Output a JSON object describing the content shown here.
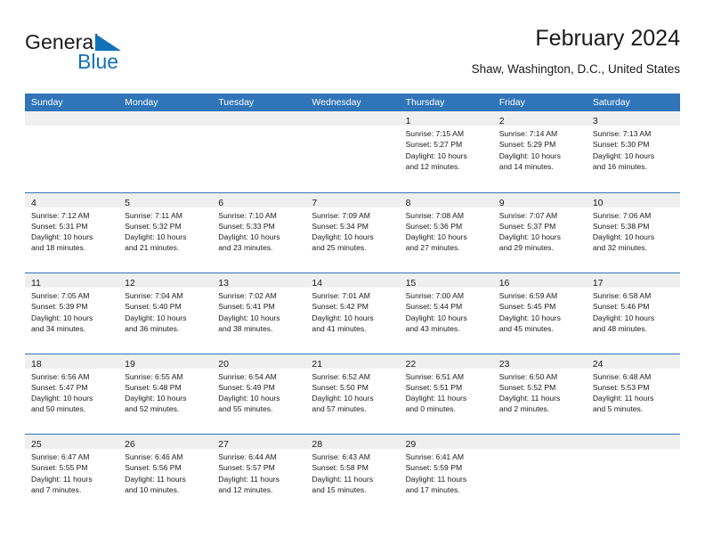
{
  "brand": {
    "name_top": "General",
    "name_bottom": "Blue",
    "triangle_color": "#1272b8",
    "text_color": "#1a1a1a"
  },
  "header": {
    "title": "February 2024",
    "subtitle": "Shaw, Washington, D.C., United States"
  },
  "theme": {
    "header_blue": "#3075b8",
    "daynum_band": "#efefef",
    "cell_bg": "#ffffff",
    "text": "#1a1a1a"
  },
  "weekdays": [
    "Sunday",
    "Monday",
    "Tuesday",
    "Wednesday",
    "Thursday",
    "Friday",
    "Saturday"
  ],
  "weeks": [
    [
      {
        "day": "",
        "sunrise": "",
        "sunset": "",
        "daylight_1": "",
        "daylight_2": ""
      },
      {
        "day": "",
        "sunrise": "",
        "sunset": "",
        "daylight_1": "",
        "daylight_2": ""
      },
      {
        "day": "",
        "sunrise": "",
        "sunset": "",
        "daylight_1": "",
        "daylight_2": ""
      },
      {
        "day": "",
        "sunrise": "",
        "sunset": "",
        "daylight_1": "",
        "daylight_2": ""
      },
      {
        "day": "1",
        "sunrise": "Sunrise: 7:15 AM",
        "sunset": "Sunset: 5:27 PM",
        "daylight_1": "Daylight: 10 hours",
        "daylight_2": "and 12 minutes."
      },
      {
        "day": "2",
        "sunrise": "Sunrise: 7:14 AM",
        "sunset": "Sunset: 5:29 PM",
        "daylight_1": "Daylight: 10 hours",
        "daylight_2": "and 14 minutes."
      },
      {
        "day": "3",
        "sunrise": "Sunrise: 7:13 AM",
        "sunset": "Sunset: 5:30 PM",
        "daylight_1": "Daylight: 10 hours",
        "daylight_2": "and 16 minutes."
      }
    ],
    [
      {
        "day": "4",
        "sunrise": "Sunrise: 7:12 AM",
        "sunset": "Sunset: 5:31 PM",
        "daylight_1": "Daylight: 10 hours",
        "daylight_2": "and 18 minutes."
      },
      {
        "day": "5",
        "sunrise": "Sunrise: 7:11 AM",
        "sunset": "Sunset: 5:32 PM",
        "daylight_1": "Daylight: 10 hours",
        "daylight_2": "and 21 minutes."
      },
      {
        "day": "6",
        "sunrise": "Sunrise: 7:10 AM",
        "sunset": "Sunset: 5:33 PM",
        "daylight_1": "Daylight: 10 hours",
        "daylight_2": "and 23 minutes."
      },
      {
        "day": "7",
        "sunrise": "Sunrise: 7:09 AM",
        "sunset": "Sunset: 5:34 PM",
        "daylight_1": "Daylight: 10 hours",
        "daylight_2": "and 25 minutes."
      },
      {
        "day": "8",
        "sunrise": "Sunrise: 7:08 AM",
        "sunset": "Sunset: 5:36 PM",
        "daylight_1": "Daylight: 10 hours",
        "daylight_2": "and 27 minutes."
      },
      {
        "day": "9",
        "sunrise": "Sunrise: 7:07 AM",
        "sunset": "Sunset: 5:37 PM",
        "daylight_1": "Daylight: 10 hours",
        "daylight_2": "and 29 minutes."
      },
      {
        "day": "10",
        "sunrise": "Sunrise: 7:06 AM",
        "sunset": "Sunset: 5:38 PM",
        "daylight_1": "Daylight: 10 hours",
        "daylight_2": "and 32 minutes."
      }
    ],
    [
      {
        "day": "11",
        "sunrise": "Sunrise: 7:05 AM",
        "sunset": "Sunset: 5:39 PM",
        "daylight_1": "Daylight: 10 hours",
        "daylight_2": "and 34 minutes."
      },
      {
        "day": "12",
        "sunrise": "Sunrise: 7:04 AM",
        "sunset": "Sunset: 5:40 PM",
        "daylight_1": "Daylight: 10 hours",
        "daylight_2": "and 36 minutes."
      },
      {
        "day": "13",
        "sunrise": "Sunrise: 7:02 AM",
        "sunset": "Sunset: 5:41 PM",
        "daylight_1": "Daylight: 10 hours",
        "daylight_2": "and 38 minutes."
      },
      {
        "day": "14",
        "sunrise": "Sunrise: 7:01 AM",
        "sunset": "Sunset: 5:42 PM",
        "daylight_1": "Daylight: 10 hours",
        "daylight_2": "and 41 minutes."
      },
      {
        "day": "15",
        "sunrise": "Sunrise: 7:00 AM",
        "sunset": "Sunset: 5:44 PM",
        "daylight_1": "Daylight: 10 hours",
        "daylight_2": "and 43 minutes."
      },
      {
        "day": "16",
        "sunrise": "Sunrise: 6:59 AM",
        "sunset": "Sunset: 5:45 PM",
        "daylight_1": "Daylight: 10 hours",
        "daylight_2": "and 45 minutes."
      },
      {
        "day": "17",
        "sunrise": "Sunrise: 6:58 AM",
        "sunset": "Sunset: 5:46 PM",
        "daylight_1": "Daylight: 10 hours",
        "daylight_2": "and 48 minutes."
      }
    ],
    [
      {
        "day": "18",
        "sunrise": "Sunrise: 6:56 AM",
        "sunset": "Sunset: 5:47 PM",
        "daylight_1": "Daylight: 10 hours",
        "daylight_2": "and 50 minutes."
      },
      {
        "day": "19",
        "sunrise": "Sunrise: 6:55 AM",
        "sunset": "Sunset: 5:48 PM",
        "daylight_1": "Daylight: 10 hours",
        "daylight_2": "and 52 minutes."
      },
      {
        "day": "20",
        "sunrise": "Sunrise: 6:54 AM",
        "sunset": "Sunset: 5:49 PM",
        "daylight_1": "Daylight: 10 hours",
        "daylight_2": "and 55 minutes."
      },
      {
        "day": "21",
        "sunrise": "Sunrise: 6:52 AM",
        "sunset": "Sunset: 5:50 PM",
        "daylight_1": "Daylight: 10 hours",
        "daylight_2": "and 57 minutes."
      },
      {
        "day": "22",
        "sunrise": "Sunrise: 6:51 AM",
        "sunset": "Sunset: 5:51 PM",
        "daylight_1": "Daylight: 11 hours",
        "daylight_2": "and 0 minutes."
      },
      {
        "day": "23",
        "sunrise": "Sunrise: 6:50 AM",
        "sunset": "Sunset: 5:52 PM",
        "daylight_1": "Daylight: 11 hours",
        "daylight_2": "and 2 minutes."
      },
      {
        "day": "24",
        "sunrise": "Sunrise: 6:48 AM",
        "sunset": "Sunset: 5:53 PM",
        "daylight_1": "Daylight: 11 hours",
        "daylight_2": "and 5 minutes."
      }
    ],
    [
      {
        "day": "25",
        "sunrise": "Sunrise: 6:47 AM",
        "sunset": "Sunset: 5:55 PM",
        "daylight_1": "Daylight: 11 hours",
        "daylight_2": "and 7 minutes."
      },
      {
        "day": "26",
        "sunrise": "Sunrise: 6:46 AM",
        "sunset": "Sunset: 5:56 PM",
        "daylight_1": "Daylight: 11 hours",
        "daylight_2": "and 10 minutes."
      },
      {
        "day": "27",
        "sunrise": "Sunrise: 6:44 AM",
        "sunset": "Sunset: 5:57 PM",
        "daylight_1": "Daylight: 11 hours",
        "daylight_2": "and 12 minutes."
      },
      {
        "day": "28",
        "sunrise": "Sunrise: 6:43 AM",
        "sunset": "Sunset: 5:58 PM",
        "daylight_1": "Daylight: 11 hours",
        "daylight_2": "and 15 minutes."
      },
      {
        "day": "29",
        "sunrise": "Sunrise: 6:41 AM",
        "sunset": "Sunset: 5:59 PM",
        "daylight_1": "Daylight: 11 hours",
        "daylight_2": "and 17 minutes."
      },
      {
        "day": "",
        "sunrise": "",
        "sunset": "",
        "daylight_1": "",
        "daylight_2": ""
      },
      {
        "day": "",
        "sunrise": "",
        "sunset": "",
        "daylight_1": "",
        "daylight_2": ""
      }
    ]
  ]
}
